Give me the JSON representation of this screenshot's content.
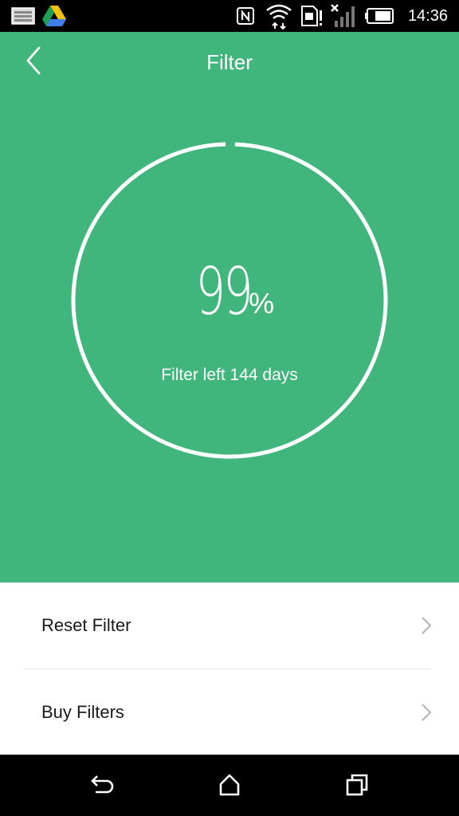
{
  "status_bar": {
    "time": "14:36",
    "icons": [
      "gallery-icon",
      "google-drive-icon",
      "nfc-icon",
      "wifi-icon",
      "sim-icon",
      "signal-icon",
      "battery-icon"
    ]
  },
  "header": {
    "title": "Filter",
    "back_icon": "chevron-left-icon"
  },
  "gauge": {
    "value": "99",
    "unit": "%",
    "percent": 99,
    "caption": "Filter left 144 days"
  },
  "list": {
    "items": [
      {
        "label": "Reset Filter",
        "icon": "chevron-right-icon"
      },
      {
        "label": "Buy Filters",
        "icon": "chevron-right-icon"
      }
    ]
  },
  "nav_bar": {
    "icons": [
      "back-icon",
      "home-icon",
      "recents-icon"
    ]
  },
  "colors": {
    "primary": "#41b67c",
    "background": "#ffffff",
    "text": "#1a1a1a",
    "chevron": "#b3b3b3"
  }
}
